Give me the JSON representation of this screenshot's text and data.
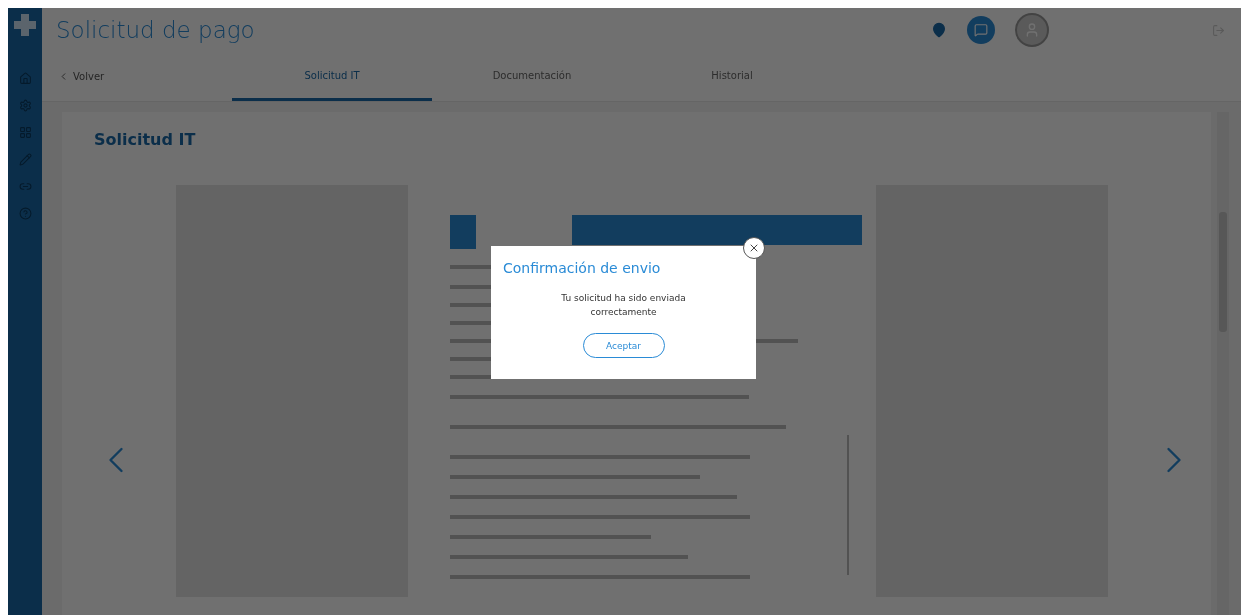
{
  "header": {
    "title": "Solicitud de pago"
  },
  "nav": {
    "back": "Volver",
    "tabs": [
      {
        "label": "Solicitud IT",
        "selected": true
      },
      {
        "label": "Documentación",
        "selected": false
      },
      {
        "label": "Historial",
        "selected": false
      }
    ]
  },
  "section": {
    "title": "Solicitud IT"
  },
  "modal": {
    "title": "Confirmación de envio",
    "message": "Tu solicitud ha sido enviada correctamente",
    "button": "Aceptar"
  }
}
